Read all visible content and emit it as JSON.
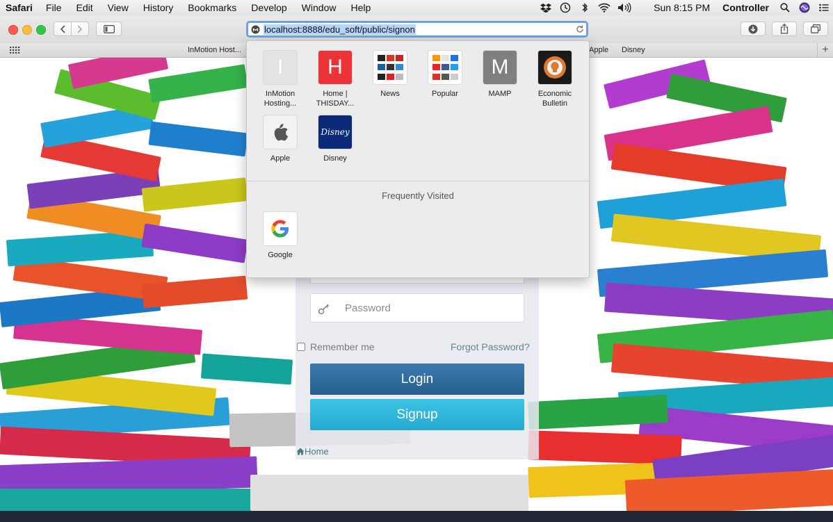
{
  "menubar": {
    "apple_icon": "apple-logo",
    "app_name": "Safari",
    "items": [
      "File",
      "Edit",
      "View",
      "History",
      "Bookmarks",
      "Develop",
      "Window",
      "Help"
    ],
    "status_icons": [
      "dropbox-icon",
      "time-machine-icon",
      "bluetooth-icon",
      "wifi-icon",
      "volume-icon"
    ],
    "clock": "Sun 8:15 PM",
    "user": "Controller"
  },
  "toolbar": {
    "url": "localhost:8888/edu_soft/public/signon",
    "traffic_colors": {
      "close": "#fc5753",
      "minimize": "#fdbc40",
      "zoom": "#33c748"
    }
  },
  "bookmarks_bar": {
    "items": [
      "InMotion Host...",
      "Apple",
      "Disney"
    ]
  },
  "favorites": [
    {
      "label": "InMotion Hosting...",
      "letter": "I",
      "color": "#e3e3e3"
    },
    {
      "label": "Home | THISDAY...",
      "letter": "H",
      "color": "#ec3338"
    },
    {
      "label": "News",
      "letter": "",
      "color": "#ffffff"
    },
    {
      "label": "Popular",
      "letter": "",
      "color": "#ffffff"
    },
    {
      "label": "MAMP",
      "letter": "M",
      "color": "#7f7f7f"
    },
    {
      "label": "Economic Bulletin",
      "letter": "",
      "color": "#1a1a1a"
    },
    {
      "label": "Apple",
      "letter": "",
      "color": "#f2f2f2"
    },
    {
      "label": "Disney",
      "letter": "Disney",
      "color": "#0a2a78"
    }
  ],
  "frequently_visited": {
    "heading": "Frequently Visited",
    "items": [
      {
        "label": "Google",
        "letter": "G"
      }
    ]
  },
  "login": {
    "password_placeholder": "Password",
    "remember_label": "Remember me",
    "forgot_link": "Forgot Password?",
    "login_button": "Login",
    "signup_button": "Signup",
    "home_link": "Home",
    "colors": {
      "login": "#2e6a9e",
      "signup": "#2fb4d8",
      "link": "#5e8a8e"
    }
  }
}
